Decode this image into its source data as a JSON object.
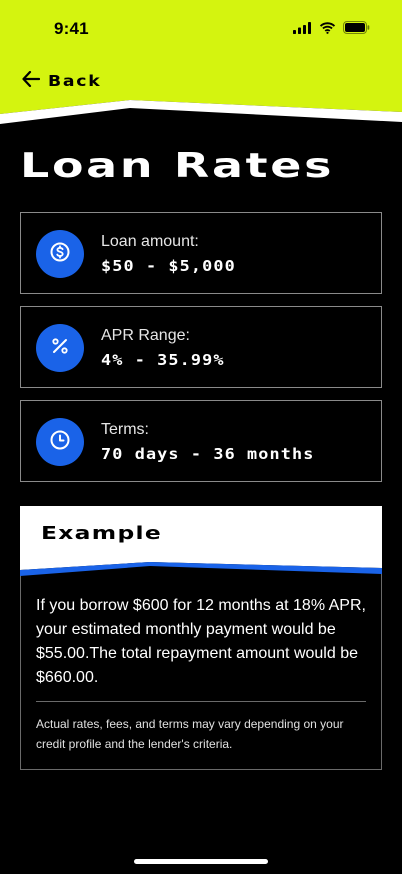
{
  "status_bar": {
    "time": "9:41"
  },
  "header": {
    "back_label": "Back",
    "accent": "#d4f40f"
  },
  "page": {
    "title": "Loan Rates"
  },
  "cards": [
    {
      "label": "Loan amount:",
      "value": "$50 - $5,000",
      "icon": "dollar-icon"
    },
    {
      "label": "APR Range:",
      "value": "4% - 35.99%",
      "icon": "percent-icon"
    },
    {
      "label": "Terms:",
      "value": "70 days - 36 months",
      "icon": "clock-icon"
    }
  ],
  "example": {
    "title": "Example",
    "body": "If you borrow $600 for 12 months at 18% APR, your estimated monthly payment would be $55.00.The total repayment amount would be $660.00.",
    "note": "Actual rates, fees, and terms may vary depending on your credit profile and the lender's criteria."
  },
  "colors": {
    "accent": "#d4f40f",
    "blue": "#1a63e8",
    "background": "#000000"
  }
}
